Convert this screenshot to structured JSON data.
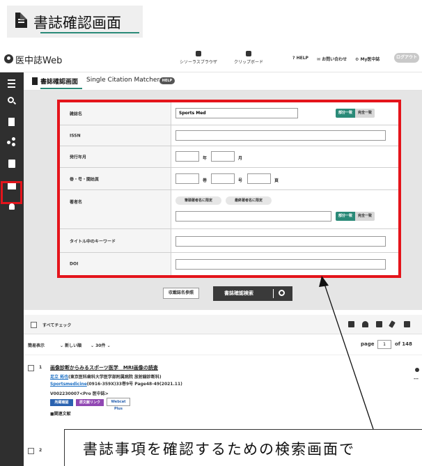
{
  "heading": {
    "title": "書誌確認画面"
  },
  "app": {
    "logo": "医中誌Web",
    "thesaurus": "シソーラスブラウザ",
    "clipboard": "クリップボード",
    "help": "HELP",
    "contact": "お問い合わせ",
    "my": "My医中誌",
    "logout": "ログアウト"
  },
  "tabs": {
    "active": "書誌確認画面",
    "other": "Single Citation Matcher",
    "help": "HELP"
  },
  "form": {
    "journal_label": "雑誌名",
    "journal_value": "Sports Med",
    "match_partial": "部分一致",
    "match_exact": "完全一致",
    "issn_label": "ISSN",
    "date_label": "発行年月",
    "year_unit": "年",
    "month_unit": "月",
    "vol_label": "巻・号・開始頁",
    "vol_unit": "巻",
    "issue_unit": "号",
    "page_unit": "頁",
    "author_label": "著者名",
    "first_author": "筆頭著者名に限定",
    "last_author": "最終著者名に限定",
    "author_match_partial": "部分一致",
    "author_match_exact": "完全一致",
    "title_label": "タイトル中のキーワード",
    "doi_label": "DOI"
  },
  "buttons": {
    "journal_ref": "収載誌名参照",
    "search": "書誌確認検索"
  },
  "results": {
    "check_all": "すべてチェック",
    "display": "簡易表示",
    "sort": "新しい順",
    "per_page": "30件",
    "page_label": "page",
    "page_value": "1",
    "of_label": "of 148",
    "go": "GO",
    "nav": "> >",
    "items": [
      {
        "num": "1",
        "title": "画像診断からみるスポーツ医学　MRI画像の読査",
        "author_link": "足立 拓也",
        "affiliation": "(東京医科歯科大学医学部附属病院 放射線診断科)",
        "journal_link": "Sportsmedicine",
        "citation": "(0916-359X)33巻9号 Page48-49(2021.11)",
        "doc_id": "V002230007<Pro 医中誌>",
        "badge1": "所蔵確認",
        "badge2": "原文献リンク",
        "badge3": "Webcat Plus",
        "extra": "関連文献"
      },
      {
        "num": "2"
      }
    ]
  },
  "callout": {
    "text": "書誌事項を確認するための検索画面で"
  }
}
